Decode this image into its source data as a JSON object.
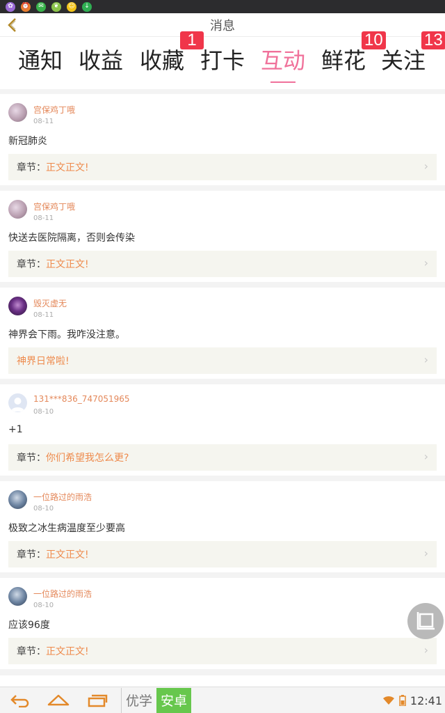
{
  "header": {
    "title": "消息"
  },
  "tabs": [
    {
      "label": "通知",
      "badge": ""
    },
    {
      "label": "收益",
      "badge": ""
    },
    {
      "label": "收藏",
      "badge": "1"
    },
    {
      "label": "打卡",
      "badge": ""
    },
    {
      "label": "互动",
      "badge": "",
      "active": true
    },
    {
      "label": "鲜花",
      "badge": "10"
    },
    {
      "label": "关注",
      "badge": "13"
    }
  ],
  "messages": [
    {
      "user": "宫保鸡丁哦",
      "date": "08-11",
      "content": "新冠肺炎",
      "chapter_label": "章节：",
      "chapter": "正文正文!"
    },
    {
      "user": "宫保鸡丁哦",
      "date": "08-11",
      "content": "快送去医院隔离，否则会传染",
      "chapter_label": "章节：",
      "chapter": "正文正文!"
    },
    {
      "user": "毁灭虚无",
      "date": "08-11",
      "content": "神界会下雨。我咋没注意。",
      "chapter_label": "",
      "chapter": "神界日常啦!"
    },
    {
      "user": "131***836_747051965",
      "date": "08-10",
      "content": "+1",
      "chapter_label": "章节：",
      "chapter": "你们希望我怎么更?"
    },
    {
      "user": "一位路过的雨浩",
      "date": "08-10",
      "content": "极致之冰生病温度至少要高",
      "chapter_label": "章节：",
      "chapter": "正文正文!"
    },
    {
      "user": "一位路过的雨浩",
      "date": "08-10",
      "content": "应该96度",
      "chapter_label": "章节：",
      "chapter": "正文正文!"
    }
  ],
  "system_bar": {
    "ime_options": [
      "优学",
      "安卓"
    ],
    "time": "12:41"
  },
  "colors": {
    "accent": "#f0719a",
    "username": "#e4885a",
    "badge": "#f0364a"
  }
}
